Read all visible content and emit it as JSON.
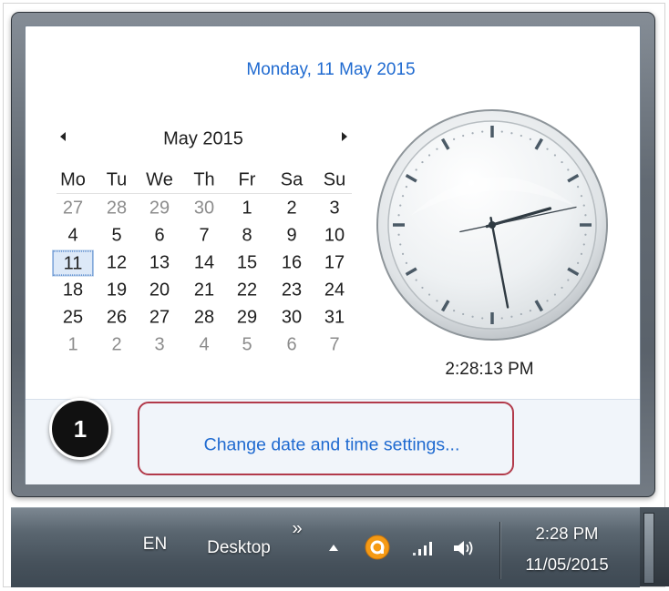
{
  "popup": {
    "date_heading": "Monday, 11 May 2015"
  },
  "calendar": {
    "month_label": "May 2015",
    "prev_icon": "triangle-left-icon",
    "next_icon": "triangle-right-icon",
    "weekdays": [
      "Mo",
      "Tu",
      "We",
      "Th",
      "Fr",
      "Sa",
      "Su"
    ],
    "selected_day": "11",
    "weeks": [
      [
        {
          "day": "27",
          "other_month": true
        },
        {
          "day": "28",
          "other_month": true
        },
        {
          "day": "29",
          "other_month": true
        },
        {
          "day": "30",
          "other_month": true
        },
        {
          "day": "1",
          "other_month": false
        },
        {
          "day": "2",
          "other_month": false
        },
        {
          "day": "3",
          "other_month": false
        }
      ],
      [
        {
          "day": "4",
          "other_month": false
        },
        {
          "day": "5",
          "other_month": false
        },
        {
          "day": "6",
          "other_month": false
        },
        {
          "day": "7",
          "other_month": false
        },
        {
          "day": "8",
          "other_month": false
        },
        {
          "day": "9",
          "other_month": false
        },
        {
          "day": "10",
          "other_month": false
        }
      ],
      [
        {
          "day": "11",
          "other_month": false
        },
        {
          "day": "12",
          "other_month": false
        },
        {
          "day": "13",
          "other_month": false
        },
        {
          "day": "14",
          "other_month": false
        },
        {
          "day": "15",
          "other_month": false
        },
        {
          "day": "16",
          "other_month": false
        },
        {
          "day": "17",
          "other_month": false
        }
      ],
      [
        {
          "day": "18",
          "other_month": false
        },
        {
          "day": "19",
          "other_month": false
        },
        {
          "day": "20",
          "other_month": false
        },
        {
          "day": "21",
          "other_month": false
        },
        {
          "day": "22",
          "other_month": false
        },
        {
          "day": "23",
          "other_month": false
        },
        {
          "day": "24",
          "other_month": false
        }
      ],
      [
        {
          "day": "25",
          "other_month": false
        },
        {
          "day": "26",
          "other_month": false
        },
        {
          "day": "27",
          "other_month": false
        },
        {
          "day": "28",
          "other_month": false
        },
        {
          "day": "29",
          "other_month": false
        },
        {
          "day": "30",
          "other_month": false
        },
        {
          "day": "31",
          "other_month": false
        }
      ],
      [
        {
          "day": "1",
          "other_month": true
        },
        {
          "day": "2",
          "other_month": true
        },
        {
          "day": "3",
          "other_month": true
        },
        {
          "day": "4",
          "other_month": true
        },
        {
          "day": "5",
          "other_month": true
        },
        {
          "day": "6",
          "other_month": true
        },
        {
          "day": "7",
          "other_month": true
        }
      ]
    ]
  },
  "clock": {
    "time": "2:28:13 PM"
  },
  "footer": {
    "link_label": "Change date and time settings..."
  },
  "callout": {
    "number": "1"
  },
  "taskbar": {
    "language": "EN",
    "desktop_label": "Desktop",
    "chevron": "»",
    "show_hidden_icon": "triangle-up-icon",
    "tray_icons": [
      "orange-app-icon",
      "network-signal-icon",
      "volume-icon"
    ],
    "time": "2:28 PM",
    "date": "11/05/2015"
  },
  "colors": {
    "link_blue": "#1f6ad0",
    "highlight_red": "#b23a4a",
    "selected_day_bg": "#dde9f8",
    "muted_day": "#8c8c8c",
    "tray_orange": "#f59a14"
  }
}
